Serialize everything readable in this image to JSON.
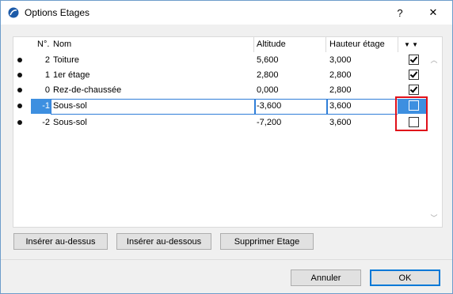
{
  "window": {
    "title": "Options Etages",
    "help_label": "?",
    "close_label": "✕"
  },
  "table": {
    "headers": {
      "num": "N°.",
      "name": "Nom",
      "altitude": "Altitude",
      "height": "Hauteur étage",
      "sort_icon": "▼ ▼"
    },
    "rows": [
      {
        "num": "2",
        "name": "Toiture",
        "altitude": "5,600",
        "height": "3,000",
        "checked": true
      },
      {
        "num": "1",
        "name": "1er étage",
        "altitude": "2,800",
        "height": "2,800",
        "checked": true
      },
      {
        "num": "0",
        "name": "Rez-de-chaussée",
        "altitude": "0,000",
        "height": "2,800",
        "checked": true
      },
      {
        "num": "-1",
        "name": "Sous-sol",
        "altitude": "-3,600",
        "height": "3,600",
        "checked": false
      },
      {
        "num": "-2",
        "name": "Sous-sol",
        "altitude": "-7,200",
        "height": "3,600",
        "checked": false
      }
    ],
    "selected_row_index": 3
  },
  "actions": {
    "insert_above": "Insérer au-dessus",
    "insert_below": "Insérer au-dessous",
    "delete_story": "Supprimer Etage"
  },
  "footer": {
    "cancel": "Annuler",
    "ok": "OK"
  },
  "colors": {
    "selection": "#3d8fe0",
    "highlight": "#e0101a",
    "edit_border": "#2f7ed8"
  }
}
